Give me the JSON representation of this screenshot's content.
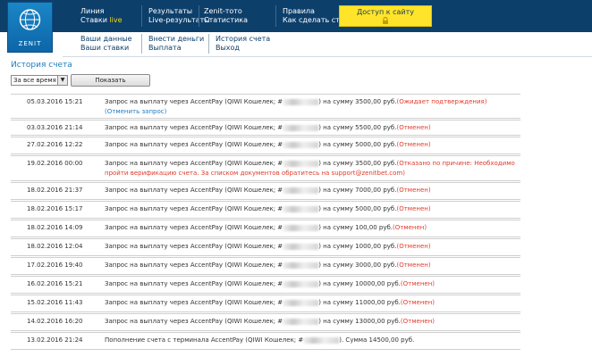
{
  "header": {
    "logo_text": "ZENIT",
    "nav": [
      {
        "line1": "Линия",
        "line2": "Ставки",
        "line2_accent": "live"
      },
      {
        "line1": "Результаты",
        "line2": "Live-результаты"
      },
      {
        "line1": "Zenit-тото",
        "line2": "Статистика"
      },
      {
        "line1": "Правила",
        "line2": "Как сделать ставку"
      }
    ],
    "access_button": "Доступ к сайту",
    "subnav": [
      {
        "line1": "Ваши данные",
        "line2": "Ваши ставки"
      },
      {
        "line1": "Внести деньги",
        "line2": "Выплата"
      },
      {
        "line1": "История счета",
        "line2": "Выход"
      }
    ],
    "colors": {
      "topbar": "#0d3f6b",
      "accent_yellow": "#ffd400",
      "access_bg": "#ffe42a"
    }
  },
  "page": {
    "title": "История счета",
    "period_select": "За все время",
    "show_button": "Показать"
  },
  "rows": [
    {
      "date": "05.03.2016 15:21",
      "pre": "Запрос на выплату через AccentPay (QIWI Кошелек; #",
      "post": ") на сумму 3500,00 руб.",
      "status": "(Ожидает подтверждения)",
      "action": "(Отменить запрос)"
    },
    {
      "date": "03.03.2016 21:14",
      "pre": "Запрос на выплату через AccentPay (QIWI Кошелек; #",
      "post": ") на сумму 5500,00 руб.",
      "status": "(Отменен)"
    },
    {
      "date": "27.02.2016 12:22",
      "pre": "Запрос на выплату через AccentPay (QIWI Кошелек; #",
      "post": ") на сумму 5000,00 руб.",
      "status": "(Отменен)"
    },
    {
      "date": "19.02.2016 00:00",
      "pre": "Запрос на выплату через AccentPay (QIWI Кошелек; #",
      "post": ") на сумму 3500,00 руб.",
      "status": "(Отказано по причине: Необходимо пройти верификацию счета. За списком документов обратитесь на support@zenitbet.com)"
    },
    {
      "date": "18.02.2016 21:37",
      "pre": "Запрос на выплату через AccentPay (QIWI Кошелек; #",
      "post": ") на сумму 7000,00 руб.",
      "status": "(Отменен)"
    },
    {
      "date": "18.02.2016 15:17",
      "pre": "Запрос на выплату через AccentPay (QIWI Кошелек; #",
      "post": ") на сумму 5000,00 руб.",
      "status": "(Отменен)"
    },
    {
      "date": "18.02.2016 14:09",
      "pre": "Запрос на выплату через AccentPay (QIWI Кошелек; #",
      "post": ") на сумму 100,00 руб.",
      "status": "(Отменен)"
    },
    {
      "date": "18.02.2016 12:04",
      "pre": "Запрос на выплату через AccentPay (QIWI Кошелек; #",
      "post": ") на сумму 1000,00 руб.",
      "status": "(Отменен)"
    },
    {
      "date": "17.02.2016 19:40",
      "pre": "Запрос на выплату через AccentPay (QIWI Кошелек; #",
      "post": ") на сумму 3000,00 руб.",
      "status": "(Отменен)"
    },
    {
      "date": "16.02.2016 15:21",
      "pre": "Запрос на выплату через AccentPay (QIWI Кошелек; #",
      "post": ") на сумму 10000,00 руб.",
      "status": "(Отменен)"
    },
    {
      "date": "15.02.2016 11:43",
      "pre": "Запрос на выплату через AccentPay (QIWI Кошелек; #",
      "post": ") на сумму 11000,00 руб.",
      "status": "(Отменен)"
    },
    {
      "date": "14.02.2016 16:20",
      "pre": "Запрос на выплату через AccentPay (QIWI Кошелек; #",
      "post": ") на сумму 13000,00 руб.",
      "status": "(Отменен)"
    },
    {
      "date": "13.02.2016 21:24",
      "pre": "Пополнение счета с терминала AccentPay (QIWI Кошелек; #",
      "post": "). Сумма 14500,00 руб."
    }
  ]
}
